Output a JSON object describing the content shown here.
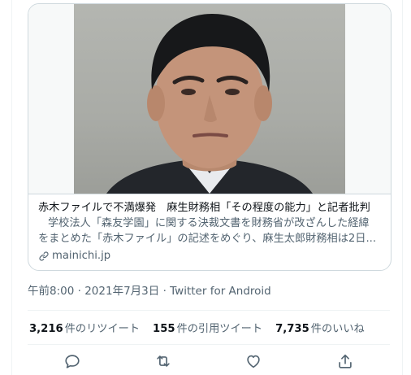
{
  "card": {
    "title": "赤木ファイルで不満爆発　麻生財務相「その程度の能力」と記者批判",
    "description_line1": "学校法人「森友学園」に関する決裁文書を財務省が改ざんした経緯",
    "description_line2": "をまとめた「赤木ファイル」の記述をめぐり、麻生太郎財務相は2日...",
    "domain": "mainichi.jp"
  },
  "meta": {
    "time": "午前8:00",
    "separator": "·",
    "date": "2021年7月3日",
    "source": "Twitter for Android"
  },
  "stats": {
    "retweets": {
      "count": "3,216",
      "label": "件のリツイート"
    },
    "quotes": {
      "count": "155",
      "label": "件の引用ツイート"
    },
    "likes": {
      "count": "7,735",
      "label": "件のいいね"
    }
  },
  "icons": {
    "reply": "reply-icon",
    "retweet": "retweet-icon",
    "like": "like-icon",
    "share": "share-icon",
    "link": "link-icon"
  },
  "colors": {
    "text": "#0f1419",
    "secondary": "#536471",
    "border": "#cfd9de"
  }
}
